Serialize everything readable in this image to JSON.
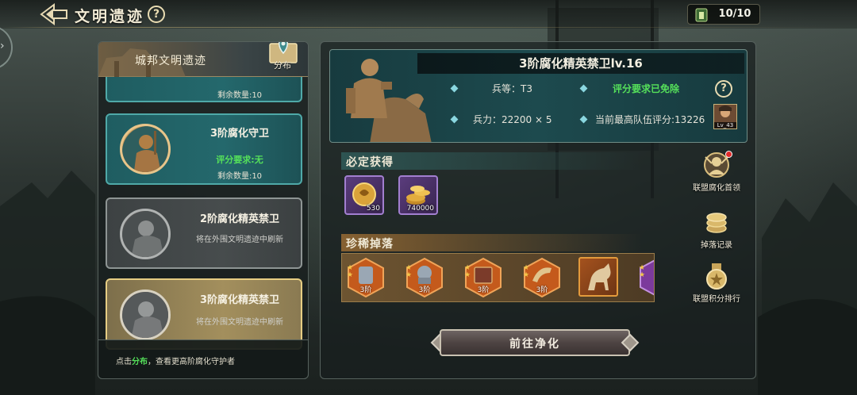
{
  "header": {
    "title": "文明遗迹",
    "help_glyph": "?",
    "stamina": "10/10"
  },
  "left_panel": {
    "header_title": "城邦文明遗迹",
    "distribution_label": "分布",
    "cards": [
      {
        "remaining": "剩余数量:10"
      },
      {
        "name": "3阶腐化守卫",
        "requirement": "评分要求:无",
        "remaining": "剩余数量:10"
      },
      {
        "name": "2阶腐化精英禁卫",
        "hint": "将在外围文明遗迹中刷新"
      },
      {
        "name": "3阶腐化精英禁卫",
        "hint": "将在外围文明遗迹中刷新"
      }
    ],
    "footer": {
      "prefix": "点击",
      "link": "分布",
      "suffix": "，查看更高阶腐化守护者"
    }
  },
  "boss": {
    "title": "3阶腐化精英禁卫lv.16",
    "tier_label": "兵等：T3",
    "score_waived": "评分要求已免除",
    "troops": "兵力：22200 × 5",
    "team_score": "当前最高队伍评分:13226",
    "player_level": "Lv_43",
    "help_glyph": "?"
  },
  "guaranteed": {
    "title": "必定获得",
    "items": [
      {
        "icon": "medal-token-icon",
        "qty": "530"
      },
      {
        "icon": "gold-coins-icon",
        "qty": "740000"
      }
    ]
  },
  "rare": {
    "title": "珍稀掉落",
    "items": [
      {
        "icon": "armor-scroll-icon",
        "tier": "3阶"
      },
      {
        "icon": "helmet-scroll-icon",
        "tier": "3阶"
      },
      {
        "icon": "book-scroll-icon",
        "tier": "3阶"
      },
      {
        "icon": "horn-scroll-icon",
        "tier": "3阶"
      },
      {
        "icon": "warhorse-icon"
      },
      {
        "icon": "partial-scroll-icon"
      }
    ]
  },
  "action": {
    "label": "前往净化"
  },
  "side_buttons": [
    {
      "label": "联盟腐化首领",
      "icon": "alliance-boss-icon"
    },
    {
      "label": "掉落记录",
      "icon": "coin-stack-icon"
    },
    {
      "label": "联盟积分排行",
      "icon": "ranking-medal-icon"
    }
  ],
  "colors": {
    "accent_green": "#55e05a",
    "panel_teal": "#1f5d61",
    "selected_gold": "#a38f5d"
  }
}
